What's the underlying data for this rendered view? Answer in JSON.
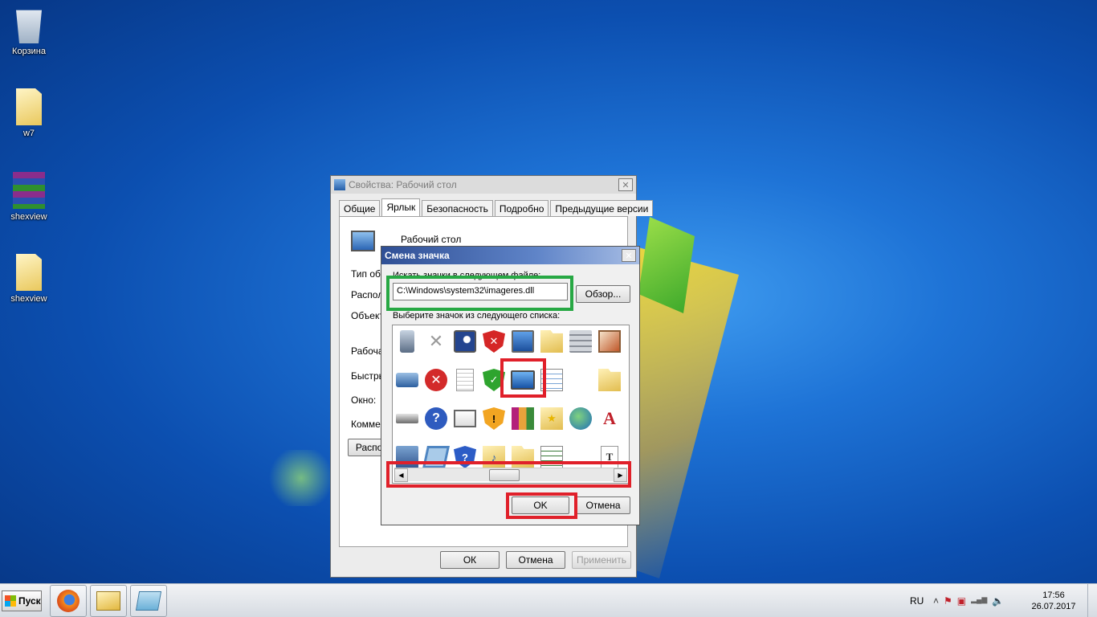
{
  "desktop": {
    "icons": [
      {
        "label": "Корзина",
        "icon": "recycle-bin-icon"
      },
      {
        "label": "w7",
        "icon": "folder-icon"
      },
      {
        "label": "shexview",
        "icon": "winrar-archive-icon"
      },
      {
        "label": "shexview",
        "icon": "folder-icon"
      }
    ]
  },
  "props_dialog": {
    "title": "Свойства: Рабочий стол",
    "tabs": [
      "Общие",
      "Ярлык",
      "Безопасность",
      "Подробно",
      "Предыдущие версии"
    ],
    "active_tab": "Ярлык",
    "shortcut_name": "Рабочий стол",
    "rows": [
      "Тип объ",
      "Располо",
      "Объект",
      "Рабочая",
      "Быстры",
      "Окно:",
      "Коммен"
    ],
    "location_button": "Распол",
    "ok": "ОК",
    "cancel": "Отмена",
    "apply": "Применить",
    "close_glyph": "✕"
  },
  "change_icon_dialog": {
    "title": "Смена значка",
    "file_label": "Искать значки в следующем файле:",
    "file_path": "C:\\Windows\\system32\\imageres.dll",
    "browse": "Обзор...",
    "list_label": "Выберите значок из следующего списка:",
    "ok": "OK",
    "cancel": "Отмена",
    "close_glyph": "✕",
    "scroll_left": "◀",
    "scroll_right": "▶",
    "icons": [
      {
        "icon": "pda-icon",
        "cls": "g-pda",
        "glyph": ""
      },
      {
        "icon": "gray-x-icon",
        "cls": "g-x",
        "glyph": "✕"
      },
      {
        "icon": "monitor-night-icon",
        "cls": "g-monitor-night",
        "glyph": ""
      },
      {
        "icon": "shield-error-icon",
        "cls": "g-shield-red",
        "glyph": "✕"
      },
      {
        "icon": "computer-icon",
        "cls": "g-computer",
        "glyph": ""
      },
      {
        "icon": "folder-icon",
        "cls": "g-folder",
        "glyph": ""
      },
      {
        "icon": "server-icon",
        "cls": "g-server",
        "glyph": ""
      },
      {
        "icon": "picture-icon",
        "cls": "g-picture",
        "glyph": ""
      },
      {
        "icon": "blank-icon",
        "cls": "g-blank",
        "glyph": ""
      },
      {
        "icon": "projector-icon",
        "cls": "g-projector",
        "glyph": ""
      },
      {
        "icon": "error-icon",
        "cls": "g-err",
        "glyph": "✕"
      },
      {
        "icon": "document-icon",
        "cls": "g-doc",
        "glyph": ""
      },
      {
        "icon": "shield-check-icon",
        "cls": "g-shield-green",
        "glyph": "✓"
      },
      {
        "icon": "desktop-icon",
        "cls": "g-desktop-blue",
        "glyph": ""
      },
      {
        "icon": "checklist-icon",
        "cls": "g-checklist",
        "glyph": ""
      },
      {
        "icon": "blank-icon",
        "cls": "g-blank",
        "glyph": ""
      },
      {
        "icon": "user-folder-icon",
        "cls": "g-user-folder",
        "glyph": ""
      },
      {
        "icon": "blank-icon",
        "cls": "g-blank",
        "glyph": ""
      },
      {
        "icon": "scanner-icon",
        "cls": "g-scanner",
        "glyph": ""
      },
      {
        "icon": "help-icon",
        "cls": "g-help",
        "glyph": "?"
      },
      {
        "icon": "easel-icon",
        "cls": "g-easel",
        "glyph": ""
      },
      {
        "icon": "shield-warning-icon",
        "cls": "g-shield-amber",
        "glyph": "!"
      },
      {
        "icon": "books-icon",
        "cls": "g-books",
        "glyph": ""
      },
      {
        "icon": "favorites-folder-icon",
        "cls": "g-star-folder",
        "glyph": "★"
      },
      {
        "icon": "network-globe-icon",
        "cls": "g-globe",
        "glyph": ""
      },
      {
        "icon": "font-icon",
        "cls": "g-font",
        "glyph": "A"
      },
      {
        "icon": "blank-icon",
        "cls": "g-blank",
        "glyph": ""
      },
      {
        "icon": "panel-icon",
        "cls": "g-panel",
        "glyph": ""
      },
      {
        "icon": "frame-icon",
        "cls": "g-frame",
        "glyph": ""
      },
      {
        "icon": "shield-help-icon",
        "cls": "g-shield-blue",
        "glyph": "?"
      },
      {
        "icon": "music-folder-icon",
        "cls": "g-music-folder",
        "glyph": "♪"
      },
      {
        "icon": "folder-icon",
        "cls": "g-folder",
        "glyph": ""
      },
      {
        "icon": "list-icon",
        "cls": "g-list",
        "glyph": ""
      },
      {
        "icon": "blank-icon",
        "cls": "g-blank",
        "glyph": ""
      },
      {
        "icon": "text-document-icon",
        "cls": "g-textdoc",
        "glyph": "T"
      },
      {
        "icon": "blank-icon",
        "cls": "g-blank",
        "glyph": ""
      }
    ]
  },
  "taskbar": {
    "start_label": "Пуск",
    "lang": "RU",
    "time": "17:56",
    "date": "26.07.2017",
    "tray_icons": [
      "chevron-up-icon",
      "action-center-icon",
      "removable-device-icon",
      "network-icon",
      "volume-icon"
    ],
    "tray_glyphs": [
      "˄",
      "⚑",
      "▣",
      "▂▄▆",
      "🔈"
    ]
  }
}
